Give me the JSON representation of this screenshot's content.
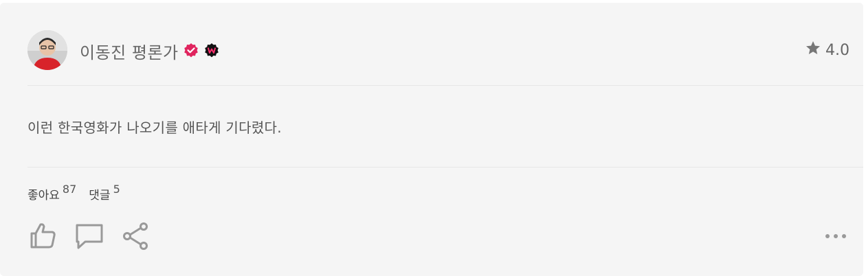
{
  "user": {
    "name": "이동진 평론가",
    "verified_icon": "verified-badge-icon",
    "watcha_icon": "w-badge-icon"
  },
  "rating": {
    "icon": "star-icon",
    "value": "4.0"
  },
  "review": {
    "text": "이런 한국영화가 나오기를 애타게 기다렸다."
  },
  "stats": {
    "likes_label": "좋아요",
    "likes_count": "87",
    "comments_label": "댓글",
    "comments_count": "5"
  },
  "actions": {
    "like_icon": "thumbs-up-icon",
    "comment_icon": "comment-icon",
    "share_icon": "share-icon",
    "more_icon": "more-icon"
  },
  "colors": {
    "card_bg": "#f5f5f5",
    "verified": "#e0245e",
    "icon_gray": "#999999"
  }
}
